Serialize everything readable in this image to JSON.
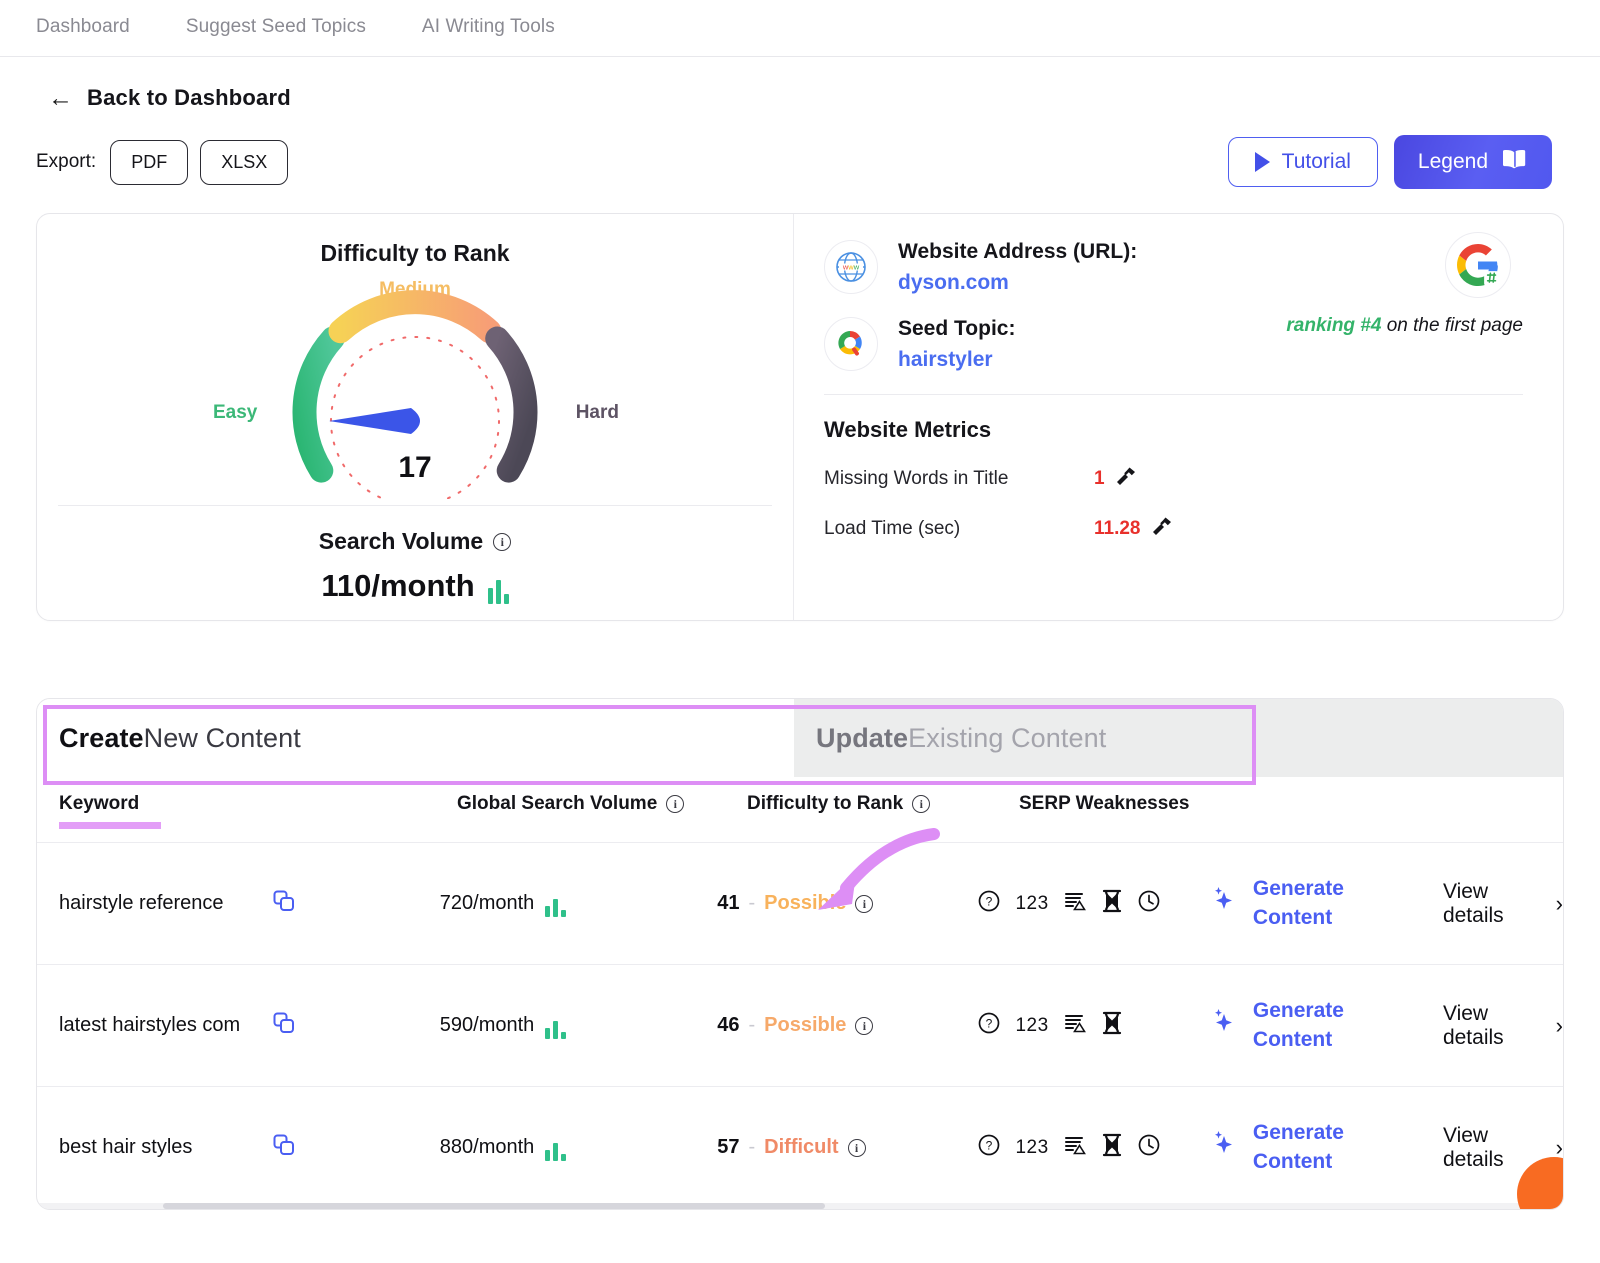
{
  "nav": {
    "items": [
      {
        "label": "Dashboard"
      },
      {
        "label": "Suggest Seed Topics"
      },
      {
        "label": "AI Writing Tools"
      }
    ]
  },
  "back": {
    "label": "Back to Dashboard",
    "icon": "arrow-left-icon",
    "glyph": "←"
  },
  "export": {
    "label": "Export:",
    "pdf": "PDF",
    "xlsx": "XLSX"
  },
  "actions": {
    "tutorial": "Tutorial",
    "legend": "Legend",
    "tutorial_icon": "play-icon",
    "legend_icon": "book-icon"
  },
  "summary": {
    "gauge_title": "Difficulty to Rank",
    "gauge_easy": "Easy",
    "gauge_medium": "Medium",
    "gauge_hard": "Hard",
    "gauge_value": "17",
    "search_volume_label": "Search Volume",
    "search_volume_value": "110/month",
    "website_address_label": "Website Address (URL):",
    "website_address_value": "dyson.com",
    "seed_topic_label": "Seed Topic:",
    "seed_topic_value": "hairstyler",
    "ranking_highlight": "ranking #4",
    "ranking_rest": " on the first page",
    "metrics_title": "Website Metrics",
    "metrics": [
      {
        "name": "Missing Words in Title",
        "value": "1"
      },
      {
        "name": "Load Time (sec)",
        "value": "11.28"
      }
    ]
  },
  "tabs": {
    "create_bold": "Create",
    "create_rest": " New Content",
    "update_bold": "Update",
    "update_rest": " Existing Content"
  },
  "table": {
    "headers": {
      "keyword": "Keyword",
      "volume": "Global Search Volume",
      "difficulty": "Difficulty to Rank",
      "serp": "SERP Weaknesses"
    },
    "rows": [
      {
        "keyword": "hairstyle reference",
        "volume": "720/month",
        "difficulty_num": "41",
        "difficulty_dash": "-",
        "difficulty_word": "Possible",
        "serp_icons": [
          "question-circle-icon",
          "123",
          "list-warning-icon",
          "hourglass-icon",
          "clock-icon"
        ],
        "generate": "Generate Content",
        "view": "View details"
      },
      {
        "keyword": "latest hairstyles com",
        "volume": "590/month",
        "difficulty_num": "46",
        "difficulty_dash": "-",
        "difficulty_word": "Possible",
        "serp_icons": [
          "question-circle-icon",
          "123",
          "list-warning-icon",
          "hourglass-icon"
        ],
        "generate": "Generate Content",
        "view": "View details"
      },
      {
        "keyword": "best hair styles",
        "volume": "880/month",
        "difficulty_num": "57",
        "difficulty_dash": "-",
        "difficulty_word": "Difficult",
        "serp_icons": [
          "question-circle-icon",
          "123",
          "list-warning-icon",
          "hourglass-icon",
          "clock-icon"
        ],
        "generate": "Generate Content",
        "view": "View details"
      }
    ]
  },
  "colors": {
    "accent_blue": "#4a5ef2",
    "easy_green": "#3cb878",
    "medium_yellow": "#f5bd63",
    "hard_purple": "#5d5364",
    "alert_red": "#e8302b",
    "annotation_purple": "#dd8ef5",
    "chat_orange": "#f86b22"
  },
  "chart_data": {
    "type": "gauge",
    "title": "Difficulty to Rank",
    "value": 17,
    "min": 0,
    "max": 100,
    "segments": [
      {
        "name": "Easy",
        "range": [
          0,
          33
        ],
        "color": "#3cb878"
      },
      {
        "name": "Medium",
        "range": [
          33,
          66
        ],
        "color": "#f5bd63"
      },
      {
        "name": "Hard",
        "range": [
          66,
          100
        ],
        "color": "#5d5364"
      }
    ],
    "secondary_metric": {
      "label": "Search Volume",
      "value": 110,
      "unit": "/month"
    }
  }
}
